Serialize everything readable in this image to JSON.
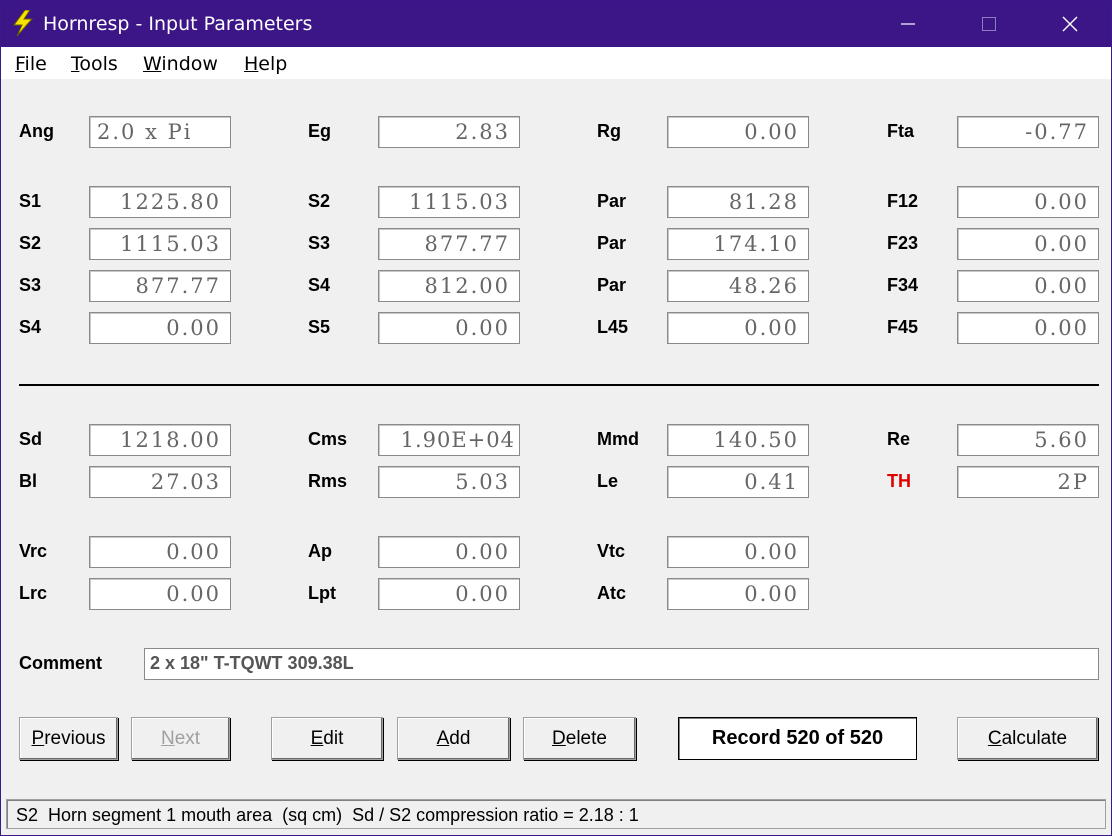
{
  "window": {
    "title": "Hornresp - Input Parameters",
    "minimize_icon": "minimize-icon",
    "maximize_icon": "maximize-icon",
    "close_icon": "close-icon",
    "colors": {
      "titlebar": "#3c1587",
      "accent_red": "#e00000"
    }
  },
  "menu": {
    "file": {
      "key": "F",
      "rest": "ile"
    },
    "tools": {
      "key": "T",
      "rest": "ools"
    },
    "window": {
      "key": "W",
      "rest": "indow"
    },
    "help": {
      "key": "H",
      "rest": "elp"
    }
  },
  "rows": {
    "ang": {
      "label": "Ang",
      "value": "2.0 x Pi"
    },
    "eg": {
      "label": "Eg",
      "value": "2.83"
    },
    "rg": {
      "label": "Rg",
      "value": "0.00"
    },
    "fta": {
      "label": "Fta",
      "value": "-0.77"
    },
    "s1": {
      "label": "S1",
      "value": "1225.80"
    },
    "s2a": {
      "label": "S2",
      "value": "1115.03"
    },
    "par1": {
      "label": "Par",
      "value": "81.28"
    },
    "f12": {
      "label": "F12",
      "value": "0.00"
    },
    "s2b": {
      "label": "S2",
      "value": "1115.03"
    },
    "s3a": {
      "label": "S3",
      "value": "877.77"
    },
    "par2": {
      "label": "Par",
      "value": "174.10"
    },
    "f23": {
      "label": "F23",
      "value": "0.00"
    },
    "s3b": {
      "label": "S3",
      "value": "877.77"
    },
    "s4a": {
      "label": "S4",
      "value": "812.00"
    },
    "par3": {
      "label": "Par",
      "value": "48.26"
    },
    "f34": {
      "label": "F34",
      "value": "0.00"
    },
    "s4b": {
      "label": "S4",
      "value": "0.00"
    },
    "s5": {
      "label": "S5",
      "value": "0.00"
    },
    "l45": {
      "label": "L45",
      "value": "0.00"
    },
    "f45": {
      "label": "F45",
      "value": "0.00"
    },
    "sd": {
      "label": "Sd",
      "value": "1218.00"
    },
    "cms": {
      "label": "Cms",
      "value": "1.90E+04"
    },
    "mmd": {
      "label": "Mmd",
      "value": "140.50"
    },
    "re": {
      "label": "Re",
      "value": "5.60"
    },
    "bl": {
      "label": "Bl",
      "value": "27.03"
    },
    "rms": {
      "label": "Rms",
      "value": "5.03"
    },
    "le": {
      "label": "Le",
      "value": "0.41"
    },
    "th": {
      "label": "TH",
      "value": "2P"
    },
    "vrc": {
      "label": "Vrc",
      "value": "0.00"
    },
    "ap": {
      "label": "Ap",
      "value": "0.00"
    },
    "vtc": {
      "label": "Vtc",
      "value": "0.00"
    },
    "lrc": {
      "label": "Lrc",
      "value": "0.00"
    },
    "lpt": {
      "label": "Lpt",
      "value": "0.00"
    },
    "atc": {
      "label": "Atc",
      "value": "0.00"
    }
  },
  "comment": {
    "label": "Comment",
    "value": "2 x 18\" T-TQWT 309.38L"
  },
  "buttons": {
    "previous": {
      "key": "P",
      "rest": "revious"
    },
    "next": {
      "key": "N",
      "rest": "ext"
    },
    "edit": {
      "key": "E",
      "rest": "dit"
    },
    "add": {
      "key": "A",
      "rest": "dd"
    },
    "delete": {
      "key": "D",
      "rest": "elete"
    },
    "calculate": {
      "key": "C",
      "rest": "alculate"
    }
  },
  "record": "Record 520 of 520",
  "status": "S2  Horn segment 1 mouth area  (sq cm)  Sd / S2 compression ratio = 2.18 : 1"
}
